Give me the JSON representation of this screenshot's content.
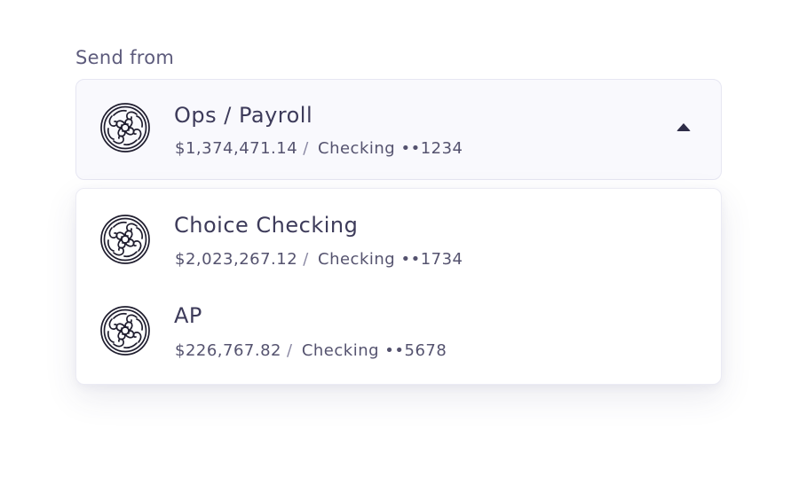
{
  "label": "Send from",
  "selected": {
    "name": "Ops / Payroll",
    "balance": "$1,374,471.14",
    "separator": "/",
    "type": "Checking",
    "mask": "••1234",
    "icon": "account-seal-icon",
    "toggle_icon": "caret-up-icon"
  },
  "options": [
    {
      "name": "Choice Checking",
      "balance": "$2,023,267.12",
      "separator": "/",
      "type": "Checking",
      "mask": "••1734",
      "icon": "account-seal-icon"
    },
    {
      "name": "AP",
      "balance": "$226,767.82",
      "separator": "/",
      "type": "Checking",
      "mask": "••5678",
      "icon": "account-seal-icon"
    }
  ],
  "colors": {
    "text": "#3d3b5a",
    "muted": "#55536f",
    "selector_bg": "#f9f9fd",
    "border": "#e6e6f2"
  }
}
